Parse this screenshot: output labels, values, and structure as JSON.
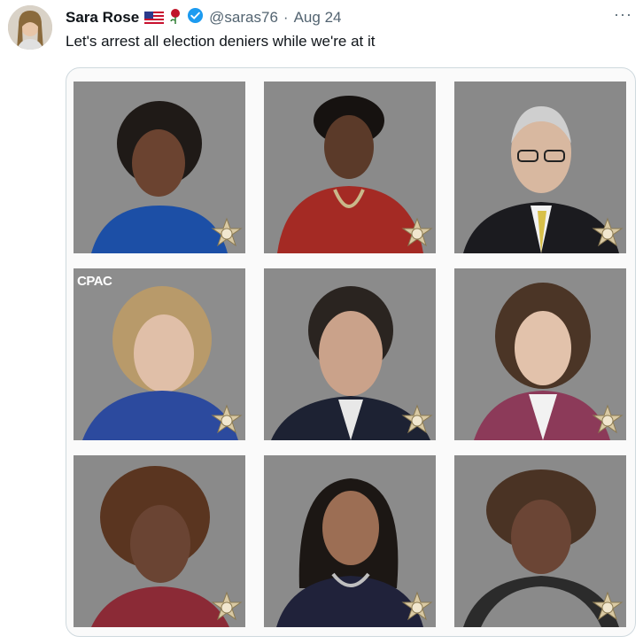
{
  "tweet": {
    "author_name": "Sara Rose",
    "handle": "@saras76",
    "separator": "·",
    "date": "Aug 24",
    "text": "Let's arrest all election deniers while we're at it",
    "more_label": "···"
  },
  "icons": {
    "flag": "us-flag-icon",
    "rose": "rose-icon",
    "verified": "verified-badge-icon",
    "badge": "sheriff-badge-icon"
  },
  "media": {
    "cpac_logo_text": "CPAC",
    "photo_count": 9
  },
  "colors": {
    "text_primary": "#0f1419",
    "text_secondary": "#536471",
    "verified_blue": "#1d9bf0",
    "photo_background": "#8a8a8a",
    "media_border": "#cfd9de"
  }
}
